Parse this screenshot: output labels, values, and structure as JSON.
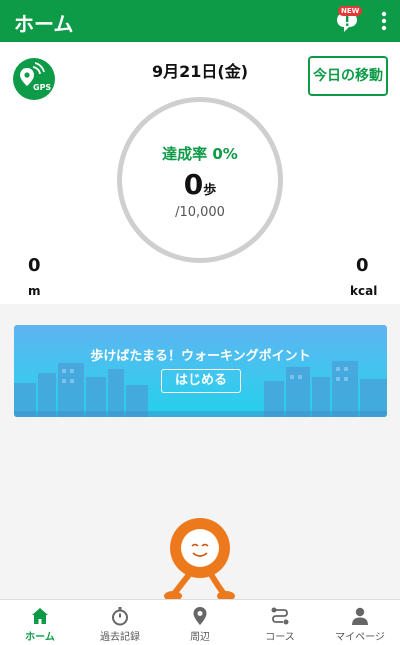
{
  "appbar": {
    "title": "ホーム",
    "notification_badge": "NEW"
  },
  "header": {
    "gps_label": "GPS",
    "date": "9月21日(金)",
    "move_button": "今日の移動"
  },
  "progress": {
    "rate_label": "達成率 0%",
    "steps": "0",
    "steps_unit": "歩",
    "goal": "/10,000"
  },
  "stats": {
    "distance_value": "0",
    "distance_unit": "m",
    "calories_value": "0",
    "calories_unit": "kcal"
  },
  "banner": {
    "title": "歩けばたまる！ウォーキングポイント",
    "button": "はじめる"
  },
  "nav": {
    "items": [
      {
        "label": "ホーム",
        "icon": "home-icon",
        "active": true
      },
      {
        "label": "過去記録",
        "icon": "stopwatch-icon",
        "active": false
      },
      {
        "label": "周辺",
        "icon": "map-pin-icon",
        "active": false
      },
      {
        "label": "コース",
        "icon": "route-icon",
        "active": false
      },
      {
        "label": "マイページ",
        "icon": "person-icon",
        "active": false
      }
    ]
  },
  "colors": {
    "brand": "#0e9b48",
    "mascot": "#ec7a1c",
    "banner": "#3fc6ef"
  }
}
